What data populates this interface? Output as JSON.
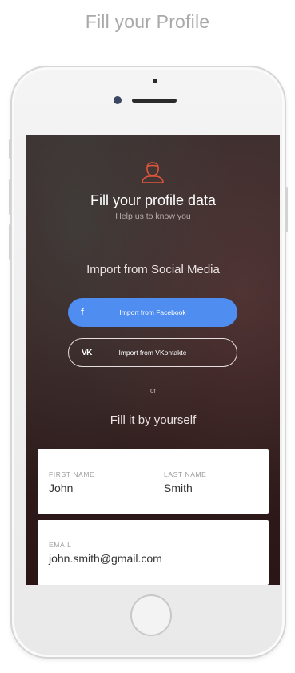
{
  "page": {
    "heading": "Fill your Profile"
  },
  "screen": {
    "title": "Fill your profile data",
    "subtitle": "Help us to know you",
    "social_heading": "Import from Social Media",
    "facebook_button": {
      "label": "Import from Facebook",
      "icon": "f"
    },
    "vk_button": {
      "label": "Import from VKontakte",
      "icon": "VK"
    },
    "divider": "or",
    "manual_heading": "Fill it by yourself",
    "form": {
      "first_name": {
        "label": "FIRST NAME",
        "value": "John"
      },
      "last_name": {
        "label": "LAST NAME",
        "value": "Smith"
      },
      "email": {
        "label": "EMAIL",
        "value": "john.smith@gmail.com"
      }
    }
  },
  "colors": {
    "facebook": "#4f8ef0",
    "accent_icon": "#e0563b",
    "screen_background": "#3a2424"
  }
}
